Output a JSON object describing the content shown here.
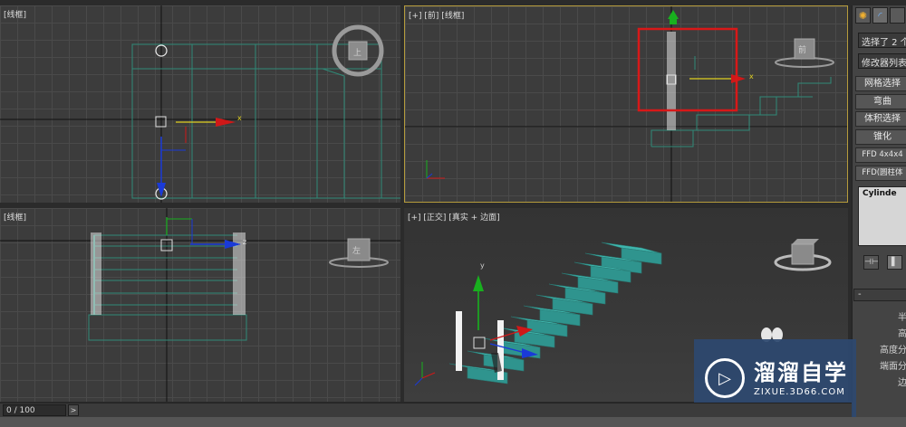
{
  "viewports": {
    "top": {
      "label": "[线框]"
    },
    "front": {
      "label": "[+] [前] [线框]",
      "viewcube": "前"
    },
    "left": {
      "label": "[线框]",
      "viewcube": "左"
    },
    "perspective": {
      "label": "[+] [正交] [真实 + 边面]"
    }
  },
  "gizmo_axis_labels": {
    "x": "x",
    "y": "y",
    "z": "z"
  },
  "command_panel": {
    "tabs": [
      {
        "name": "create-tab-icon",
        "glyph": "✺"
      },
      {
        "name": "modify-tab-icon",
        "glyph": "◜"
      },
      {
        "name": "hierarchy-tab-icon",
        "glyph": ""
      }
    ],
    "selection_field": "选择了 2 个",
    "modifier_list": "修改器列表",
    "modifier_buttons": [
      "网格选择",
      "弯曲",
      "体积选择",
      "锥化",
      "FFD 4x4x4",
      "FFD(圆柱体"
    ],
    "stack_item": "Cylinde",
    "stack_buttons": [
      "⊣⊢",
      "▌"
    ],
    "rollout": "-",
    "parameters": [
      "半",
      "高",
      "高度分",
      "端面分",
      "边"
    ]
  },
  "timeline": {
    "frame": "0 / 100",
    "next": ">"
  },
  "watermark": {
    "name": "溜溜自学",
    "url": "ZIXUE.3D66.COM",
    "logo_glyph": "▷"
  },
  "colors": {
    "viewport_bg": "#3c3c3c",
    "grid_line": "#4a4a4a",
    "active_border": "#b59b3c",
    "stair_teal": "#3aa6a0",
    "wire_green": "#2f8a78",
    "axis_x": "#e01a1a",
    "axis_y": "#18b01e",
    "axis_z": "#1a3ad8",
    "highlight_box": "#d81818",
    "watermark_bg": "#2e4970"
  }
}
